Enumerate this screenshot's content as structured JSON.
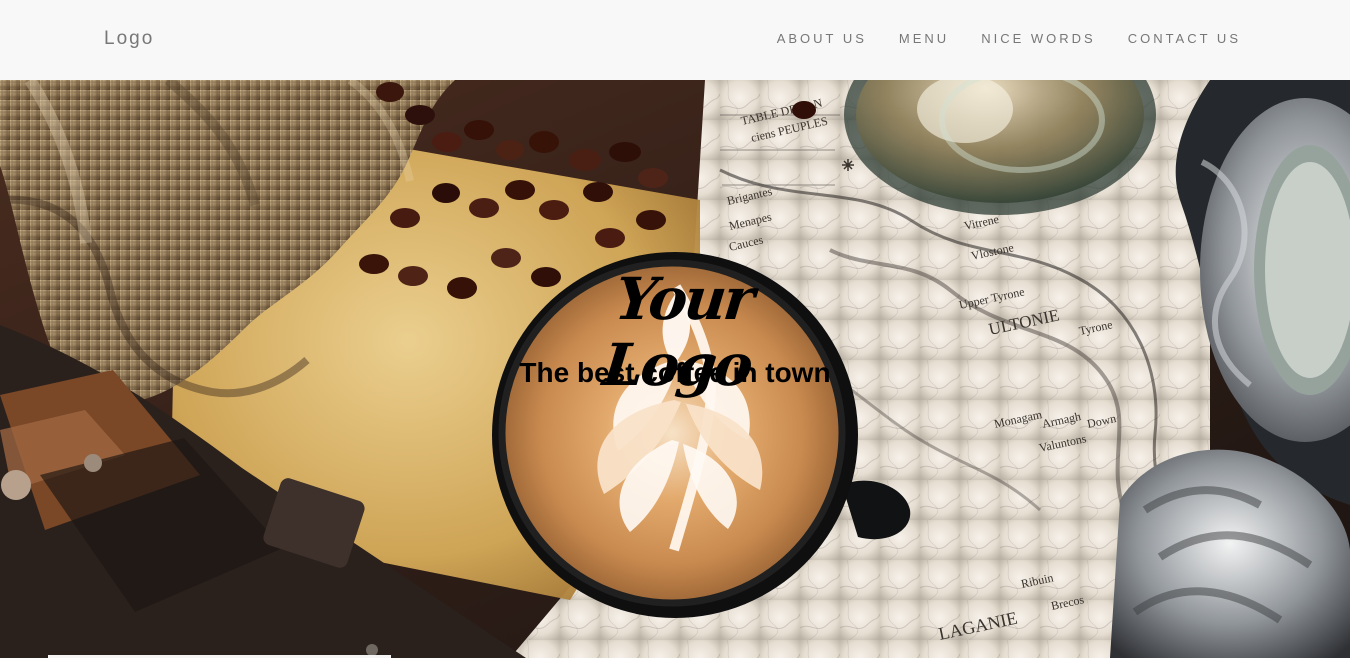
{
  "header": {
    "brand": "Logo",
    "nav": [
      {
        "label": "ABOUT US"
      },
      {
        "label": "MENU"
      },
      {
        "label": "NICE WORDS"
      },
      {
        "label": "CONTACT US"
      }
    ]
  },
  "hero": {
    "logo_text": "Your Logo",
    "tagline": "The best coffee in town"
  },
  "map_labels": [
    "TABLE DES AN",
    "ciens PEUPLES",
    "Vitrene",
    "Vlostone",
    "ULTONIE",
    "Upper Tyrone",
    "Tyrone",
    "Armagh",
    "Down",
    "Monagam",
    "Valuntons",
    "Brigantes",
    "Menapes",
    "Cauces",
    "LAGANIE",
    "Ribuin",
    "Brecos"
  ],
  "colors": {
    "header_bg": "#f8f8f8",
    "nav_text": "#777777",
    "hero_text": "#000000"
  }
}
